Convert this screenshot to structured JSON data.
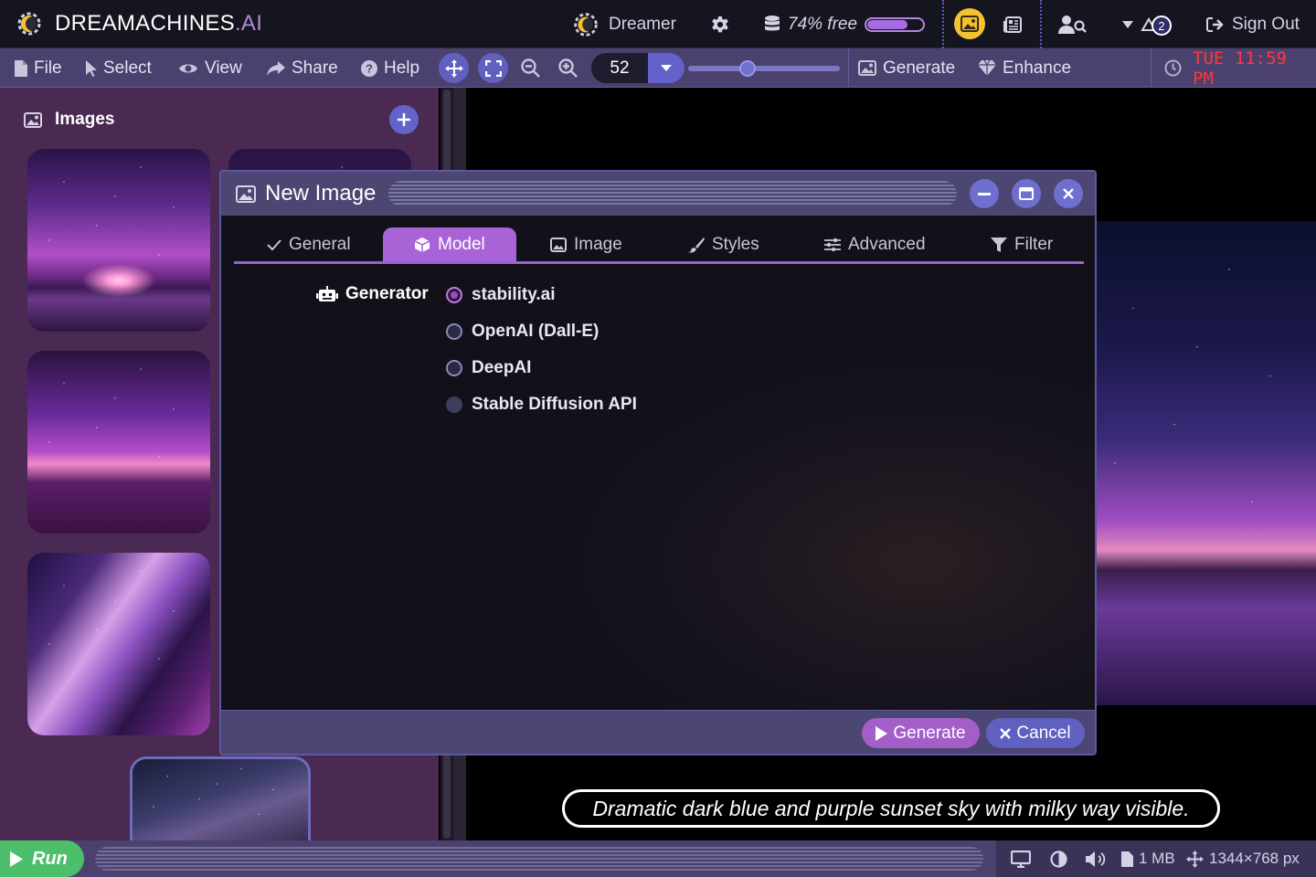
{
  "app": {
    "brand_main": "DREAMACHINES",
    "brand_suffix": ".AI",
    "profile_name": "Dreamer",
    "storage_text": "74% free",
    "storage_free_fraction": 0.74,
    "notifications_count": "2",
    "sign_out": "Sign Out"
  },
  "menu": {
    "file": "File",
    "select": "Select",
    "view": "View",
    "share": "Share",
    "help": "Help",
    "zoom_value": "52",
    "zoom_slider_fraction": 0.38,
    "generate": "Generate",
    "enhance": "Enhance",
    "clock": "TUE 11:59 PM"
  },
  "sidebar": {
    "title": "Images"
  },
  "dialog": {
    "title": "New Image",
    "tabs": [
      "General",
      "Model",
      "Image",
      "Styles",
      "Advanced",
      "Filter"
    ],
    "active_tab": "Model",
    "generator_label": "Generator",
    "options": [
      "stability.ai",
      "OpenAI (Dall-E)",
      "DeepAI",
      "Stable Diffusion API"
    ],
    "selected_option": "stability.ai",
    "disabled_option": "Stable Diffusion API",
    "generate_button": "Generate",
    "cancel_button": "Cancel"
  },
  "canvas": {
    "caption": "Dramatic dark blue and purple sunset sky with milky way visible."
  },
  "status": {
    "run": "Run",
    "file_size": "1 MB",
    "dimensions": "1344×768 px"
  },
  "colors": {
    "accent_purple": "#a864d6",
    "button_blue": "#6060c0",
    "run_green": "#4cbf6a",
    "clock_red": "#ff3838",
    "gallery_yellow": "#f2c233"
  },
  "icons": [
    "logo-icon",
    "gear-icon",
    "database-icon",
    "gallery-icon",
    "newspaper-icon",
    "user-search-icon",
    "bell-icon",
    "sign-out-icon",
    "file-icon",
    "cursor-icon",
    "eye-icon",
    "share-icon",
    "help-icon",
    "move-icon",
    "expand-icon",
    "zoom-out-icon",
    "zoom-in-icon",
    "image-icon",
    "gem-icon",
    "clock-icon",
    "plus-icon",
    "robot-icon",
    "check-icon",
    "cube-icon",
    "brush-icon",
    "sliders-icon",
    "filter-icon",
    "play-icon",
    "x-icon",
    "monitor-icon",
    "contrast-icon",
    "volume-icon"
  ]
}
